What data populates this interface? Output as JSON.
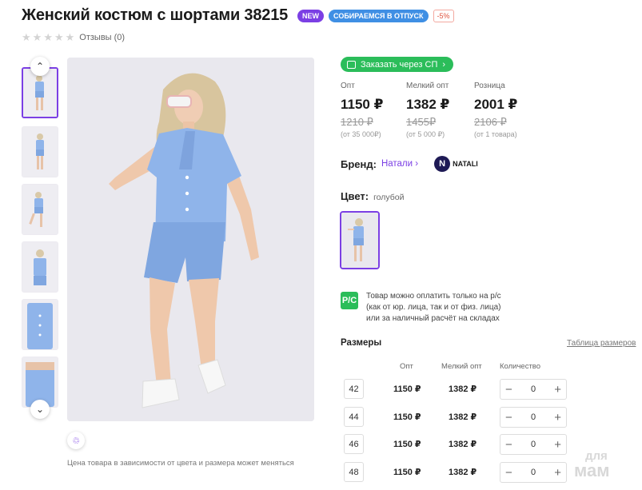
{
  "product": {
    "title": "Женский костюм с шортами 38215",
    "badges": {
      "new": "NEW",
      "vacation": "СОБИРАЕМСЯ В ОТПУСК",
      "discount": "-5%"
    },
    "reviews": "Отзывы (0)",
    "stars": [
      "★",
      "★",
      "★",
      "★",
      "★"
    ]
  },
  "gallery": {
    "up_arrow": "⌃",
    "down_arrow": "⌄",
    "hanger_icon": "♲",
    "note": "Цена товара в зависимости от цвета и размера может меняться"
  },
  "sp_button": "Заказать через СП",
  "prices": [
    {
      "label": "Опт",
      "value": "1150 ₽",
      "old": "1210 ₽",
      "min": "(от 35 000₽)"
    },
    {
      "label": "Мелкий опт",
      "value": "1382 ₽",
      "old": "1455₽",
      "min": "(от 5 000 ₽)"
    },
    {
      "label": "Розница",
      "value": "2001 ₽",
      "old": "2106 ₽",
      "min": "(от 1 товара)"
    }
  ],
  "brand": {
    "label": "Бренд:",
    "name": "Натали",
    "logo_letter": "N",
    "logo_text": "NATALI"
  },
  "color": {
    "label": "Цвет:",
    "value": "голубой"
  },
  "payment": {
    "icon_text": "Р/С",
    "lines": [
      "Товар можно оплатить только на р/с",
      "(как от юр. лица, так и от физ. лица)",
      "или за наличный расчёт на складах"
    ]
  },
  "sizes": {
    "title": "Размеры",
    "table_link": "Таблица размеров",
    "headers": {
      "opt": "Опт",
      "small": "Мелкий опт",
      "qty": "Количество"
    },
    "rows": [
      {
        "size": "42",
        "opt": "1150 ₽",
        "small": "1382 ₽",
        "qty": "0"
      },
      {
        "size": "44",
        "opt": "1150 ₽",
        "small": "1382 ₽",
        "qty": "0"
      },
      {
        "size": "46",
        "opt": "1150 ₽",
        "small": "1382 ₽",
        "qty": "0"
      },
      {
        "size": "48",
        "opt": "1150 ₽",
        "small": "1382 ₽",
        "qty": "0"
      }
    ],
    "minus": "−",
    "plus": "+"
  },
  "watermark": {
    "line1": "для",
    "line2": "мам"
  },
  "colors": {
    "accent": "#7b3fe4",
    "green": "#2bbd5a",
    "outfit": "#8fb4ea"
  }
}
